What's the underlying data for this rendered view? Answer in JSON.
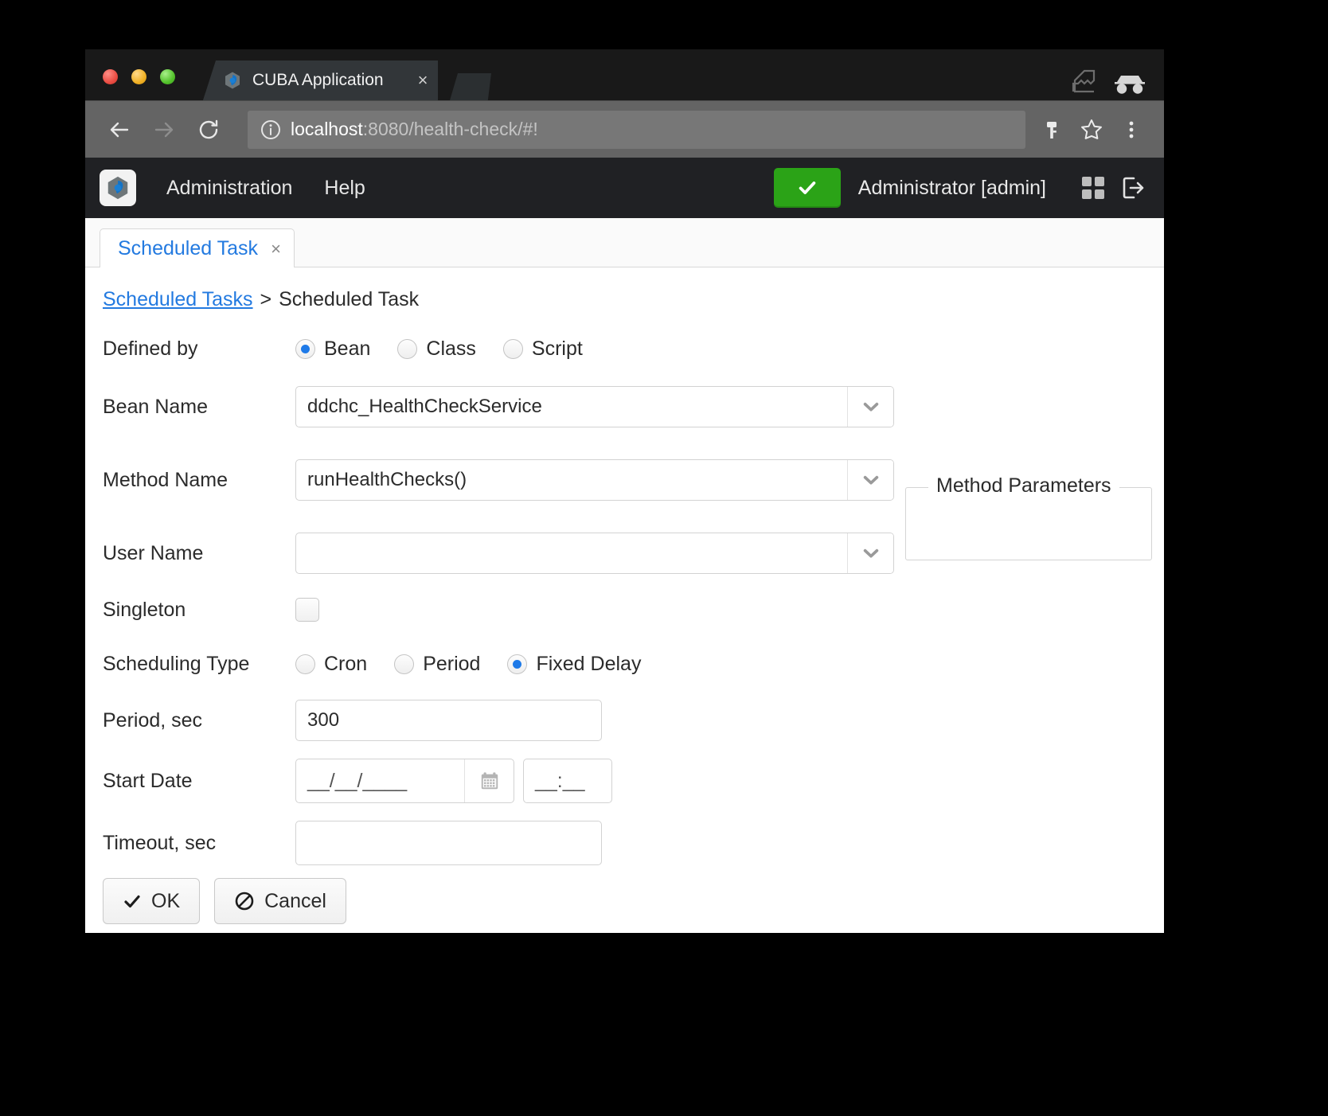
{
  "browser": {
    "tab": {
      "title": "CUBA Application",
      "favicon": "cuba-logo-icon",
      "close": "×"
    },
    "new_tab": "new-tab-button",
    "nav": {
      "back": "←",
      "forward": "→",
      "reload": "↻"
    },
    "omnibox": {
      "site_info_icon": "info-circle-icon",
      "host": "localhost",
      "path": ":8080/health-check/#!"
    },
    "right_icons": [
      "password-key-icon",
      "bookmark-star-icon",
      "browser-menu-icon"
    ],
    "window_icons": [
      "window-restore-icon",
      "incognito-glasses-icon"
    ]
  },
  "app_header": {
    "logo": "cuba-logo-icon",
    "menu": [
      {
        "label": "Administration"
      },
      {
        "label": "Help"
      }
    ],
    "health_indicator": {
      "icon": "check-icon",
      "color": "#2ba317"
    },
    "user": "Administrator [admin]",
    "icons": [
      "app-grid-icon",
      "logout-icon"
    ]
  },
  "tabsheet": {
    "tab_label": "Scheduled Task",
    "tab_close": "×"
  },
  "breadcrumb": {
    "link": "Scheduled Tasks",
    "separator": ">",
    "current": "Scheduled Task"
  },
  "form": {
    "defined_by": {
      "label": "Defined by",
      "options": [
        {
          "label": "Bean",
          "checked": true
        },
        {
          "label": "Class",
          "checked": false
        },
        {
          "label": "Script",
          "checked": false
        }
      ]
    },
    "bean_name": {
      "label": "Bean Name",
      "value": "ddchc_HealthCheckService"
    },
    "method_name": {
      "label": "Method Name",
      "value": "runHealthChecks()"
    },
    "user_name": {
      "label": "User Name",
      "value": ""
    },
    "singleton": {
      "label": "Singleton",
      "checked": false
    },
    "scheduling_type": {
      "label": "Scheduling Type",
      "options": [
        {
          "label": "Cron",
          "checked": false
        },
        {
          "label": "Period",
          "checked": false
        },
        {
          "label": "Fixed Delay",
          "checked": true
        }
      ]
    },
    "period_sec": {
      "label": "Period, sec",
      "value": "300"
    },
    "start_date": {
      "label": "Start Date",
      "date_mask": "__/__/____",
      "time_mask": "__:__",
      "picker_icon": "calendar-icon"
    },
    "timeout_sec": {
      "label": "Timeout, sec",
      "value": ""
    },
    "method_parameters": {
      "legend": "Method Parameters"
    },
    "buttons": {
      "ok": {
        "label": "OK",
        "icon": "check-icon"
      },
      "cancel": {
        "label": "Cancel",
        "icon": "ban-icon"
      }
    }
  }
}
